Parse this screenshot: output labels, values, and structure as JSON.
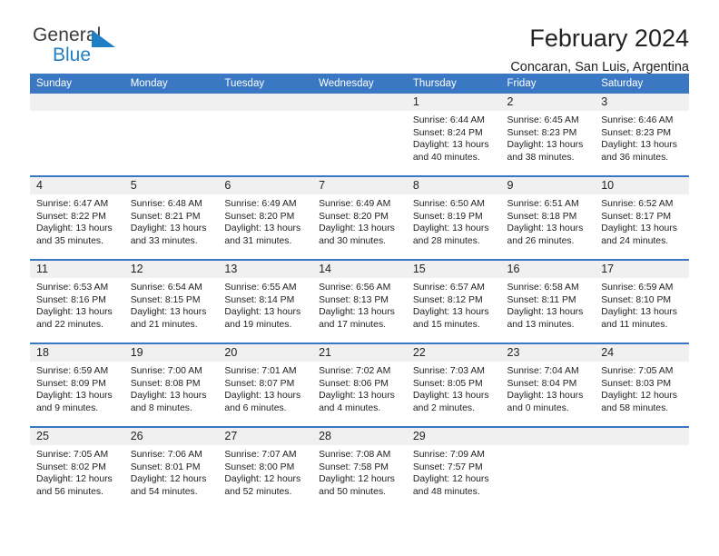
{
  "brand": {
    "name_part1": "General",
    "name_part2": "Blue",
    "mark": "triangle-logo-icon",
    "color_dark": "#3c3c3c",
    "color_blue": "#1f7fc4"
  },
  "header": {
    "title": "February 2024",
    "subtitle": "Concaran, San Luis, Argentina"
  },
  "theme": {
    "header_blue": "#3b78c3",
    "daynum_gray": "#f0f0f0",
    "text": "#222222"
  },
  "calendar": {
    "weekday_headers": [
      "Sunday",
      "Monday",
      "Tuesday",
      "Wednesday",
      "Thursday",
      "Friday",
      "Saturday"
    ],
    "weeks": [
      [
        {
          "day": "",
          "lines": []
        },
        {
          "day": "",
          "lines": []
        },
        {
          "day": "",
          "lines": []
        },
        {
          "day": "",
          "lines": []
        },
        {
          "day": "1",
          "lines": [
            "Sunrise: 6:44 AM",
            "Sunset: 8:24 PM",
            "Daylight: 13 hours",
            "and 40 minutes."
          ]
        },
        {
          "day": "2",
          "lines": [
            "Sunrise: 6:45 AM",
            "Sunset: 8:23 PM",
            "Daylight: 13 hours",
            "and 38 minutes."
          ]
        },
        {
          "day": "3",
          "lines": [
            "Sunrise: 6:46 AM",
            "Sunset: 8:23 PM",
            "Daylight: 13 hours",
            "and 36 minutes."
          ]
        }
      ],
      [
        {
          "day": "4",
          "lines": [
            "Sunrise: 6:47 AM",
            "Sunset: 8:22 PM",
            "Daylight: 13 hours",
            "and 35 minutes."
          ]
        },
        {
          "day": "5",
          "lines": [
            "Sunrise: 6:48 AM",
            "Sunset: 8:21 PM",
            "Daylight: 13 hours",
            "and 33 minutes."
          ]
        },
        {
          "day": "6",
          "lines": [
            "Sunrise: 6:49 AM",
            "Sunset: 8:20 PM",
            "Daylight: 13 hours",
            "and 31 minutes."
          ]
        },
        {
          "day": "7",
          "lines": [
            "Sunrise: 6:49 AM",
            "Sunset: 8:20 PM",
            "Daylight: 13 hours",
            "and 30 minutes."
          ]
        },
        {
          "day": "8",
          "lines": [
            "Sunrise: 6:50 AM",
            "Sunset: 8:19 PM",
            "Daylight: 13 hours",
            "and 28 minutes."
          ]
        },
        {
          "day": "9",
          "lines": [
            "Sunrise: 6:51 AM",
            "Sunset: 8:18 PM",
            "Daylight: 13 hours",
            "and 26 minutes."
          ]
        },
        {
          "day": "10",
          "lines": [
            "Sunrise: 6:52 AM",
            "Sunset: 8:17 PM",
            "Daylight: 13 hours",
            "and 24 minutes."
          ]
        }
      ],
      [
        {
          "day": "11",
          "lines": [
            "Sunrise: 6:53 AM",
            "Sunset: 8:16 PM",
            "Daylight: 13 hours",
            "and 22 minutes."
          ]
        },
        {
          "day": "12",
          "lines": [
            "Sunrise: 6:54 AM",
            "Sunset: 8:15 PM",
            "Daylight: 13 hours",
            "and 21 minutes."
          ]
        },
        {
          "day": "13",
          "lines": [
            "Sunrise: 6:55 AM",
            "Sunset: 8:14 PM",
            "Daylight: 13 hours",
            "and 19 minutes."
          ]
        },
        {
          "day": "14",
          "lines": [
            "Sunrise: 6:56 AM",
            "Sunset: 8:13 PM",
            "Daylight: 13 hours",
            "and 17 minutes."
          ]
        },
        {
          "day": "15",
          "lines": [
            "Sunrise: 6:57 AM",
            "Sunset: 8:12 PM",
            "Daylight: 13 hours",
            "and 15 minutes."
          ]
        },
        {
          "day": "16",
          "lines": [
            "Sunrise: 6:58 AM",
            "Sunset: 8:11 PM",
            "Daylight: 13 hours",
            "and 13 minutes."
          ]
        },
        {
          "day": "17",
          "lines": [
            "Sunrise: 6:59 AM",
            "Sunset: 8:10 PM",
            "Daylight: 13 hours",
            "and 11 minutes."
          ]
        }
      ],
      [
        {
          "day": "18",
          "lines": [
            "Sunrise: 6:59 AM",
            "Sunset: 8:09 PM",
            "Daylight: 13 hours",
            "and 9 minutes."
          ]
        },
        {
          "day": "19",
          "lines": [
            "Sunrise: 7:00 AM",
            "Sunset: 8:08 PM",
            "Daylight: 13 hours",
            "and 8 minutes."
          ]
        },
        {
          "day": "20",
          "lines": [
            "Sunrise: 7:01 AM",
            "Sunset: 8:07 PM",
            "Daylight: 13 hours",
            "and 6 minutes."
          ]
        },
        {
          "day": "21",
          "lines": [
            "Sunrise: 7:02 AM",
            "Sunset: 8:06 PM",
            "Daylight: 13 hours",
            "and 4 minutes."
          ]
        },
        {
          "day": "22",
          "lines": [
            "Sunrise: 7:03 AM",
            "Sunset: 8:05 PM",
            "Daylight: 13 hours",
            "and 2 minutes."
          ]
        },
        {
          "day": "23",
          "lines": [
            "Sunrise: 7:04 AM",
            "Sunset: 8:04 PM",
            "Daylight: 13 hours",
            "and 0 minutes."
          ]
        },
        {
          "day": "24",
          "lines": [
            "Sunrise: 7:05 AM",
            "Sunset: 8:03 PM",
            "Daylight: 12 hours",
            "and 58 minutes."
          ]
        }
      ],
      [
        {
          "day": "25",
          "lines": [
            "Sunrise: 7:05 AM",
            "Sunset: 8:02 PM",
            "Daylight: 12 hours",
            "and 56 minutes."
          ]
        },
        {
          "day": "26",
          "lines": [
            "Sunrise: 7:06 AM",
            "Sunset: 8:01 PM",
            "Daylight: 12 hours",
            "and 54 minutes."
          ]
        },
        {
          "day": "27",
          "lines": [
            "Sunrise: 7:07 AM",
            "Sunset: 8:00 PM",
            "Daylight: 12 hours",
            "and 52 minutes."
          ]
        },
        {
          "day": "28",
          "lines": [
            "Sunrise: 7:08 AM",
            "Sunset: 7:58 PM",
            "Daylight: 12 hours",
            "and 50 minutes."
          ]
        },
        {
          "day": "29",
          "lines": [
            "Sunrise: 7:09 AM",
            "Sunset: 7:57 PM",
            "Daylight: 12 hours",
            "and 48 minutes."
          ]
        },
        {
          "day": "",
          "lines": []
        },
        {
          "day": "",
          "lines": []
        }
      ]
    ]
  }
}
